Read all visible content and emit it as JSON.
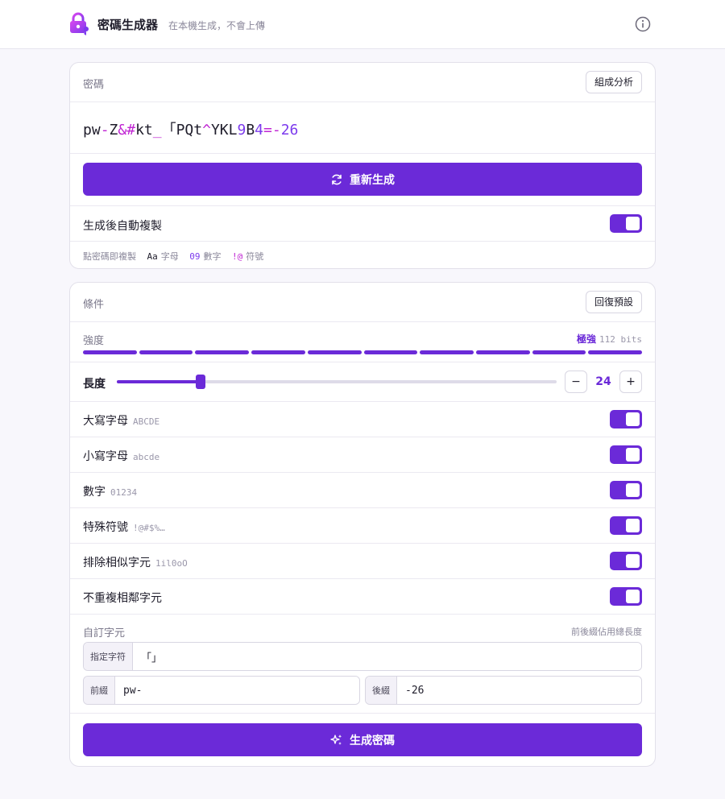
{
  "header": {
    "title": "密碼生成器",
    "subtitle": "在本機生成，不會上傳"
  },
  "password_card": {
    "label": "密碼",
    "analyze_button": "組成分析",
    "password_segments": [
      {
        "text": "pw",
        "kind": "letter"
      },
      {
        "text": "-",
        "kind": "sym"
      },
      {
        "text": "Z",
        "kind": "letter"
      },
      {
        "text": "&#",
        "kind": "sym"
      },
      {
        "text": "kt",
        "kind": "letter"
      },
      {
        "text": "_",
        "kind": "sym"
      },
      {
        "text": "「PQt",
        "kind": "letter"
      },
      {
        "text": "^",
        "kind": "sym"
      },
      {
        "text": "YKL",
        "kind": "letter"
      },
      {
        "text": "9",
        "kind": "num"
      },
      {
        "text": "B",
        "kind": "letter"
      },
      {
        "text": "4",
        "kind": "num"
      },
      {
        "text": "=-",
        "kind": "sym"
      },
      {
        "text": "26",
        "kind": "num"
      }
    ],
    "regenerate_button": "重新生成",
    "auto_copy_label": "生成後自動複製",
    "auto_copy_on": true,
    "legend": {
      "hint": "點密碼即複製",
      "letters_key": "Aa",
      "letters_label": "字母",
      "digits_key": "09",
      "digits_label": "數字",
      "symbols_key": "!@",
      "symbols_label": "符號"
    }
  },
  "conditions_card": {
    "label": "條件",
    "reset_button": "回復預設",
    "strength": {
      "label": "強度",
      "level": "極強",
      "bits": "112 bits",
      "segments_filled": 10,
      "segments_total": 10
    },
    "length": {
      "label": "長度",
      "value": "24",
      "minus": "−",
      "plus": "+",
      "slider_fraction": 0.19
    },
    "options": [
      {
        "label": "大寫字母",
        "hint": "ABCDE",
        "on": true
      },
      {
        "label": "小寫字母",
        "hint": "abcde",
        "on": true
      },
      {
        "label": "數字",
        "hint": "01234",
        "on": true
      },
      {
        "label": "特殊符號",
        "hint": "!@#$%…",
        "on": true
      },
      {
        "label": "排除相似字元",
        "hint": "1il0oO",
        "on": true
      },
      {
        "label": "不重複相鄰字元",
        "hint": "",
        "on": true
      }
    ],
    "custom": {
      "label": "自訂字元",
      "note": "前後綴佔用總長度",
      "specified_addon": "指定字符",
      "specified_value": "「」",
      "prefix_addon": "前綴",
      "prefix_value": "pw-",
      "suffix_addon": "後綴",
      "suffix_value": "-26"
    },
    "generate_button": "生成密碼"
  },
  "colors": {
    "accent": "#6b2ad8",
    "symbol": "#c026d3",
    "digit": "#7c3aed"
  }
}
